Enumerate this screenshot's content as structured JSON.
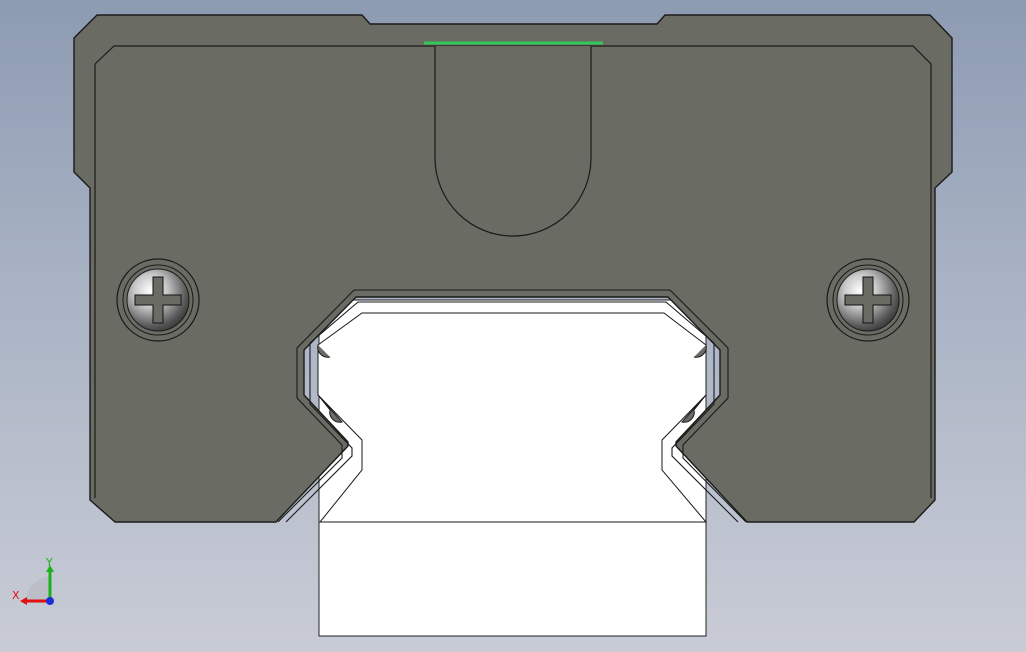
{
  "viewport": {
    "background_top": "#8d9bb2",
    "background_bottom": "#c9ccd6"
  },
  "model": {
    "block_color": "#6a6b63",
    "rail_color": "#ffffff",
    "seal_color": "#34c759",
    "screw_count": 2,
    "screw_icon": "phillips-screw-icon"
  },
  "triad": {
    "x_label": "X",
    "y_label": "Y",
    "x_color": "#e01010",
    "y_color": "#19b319",
    "z_color": "#1b2fd6"
  }
}
